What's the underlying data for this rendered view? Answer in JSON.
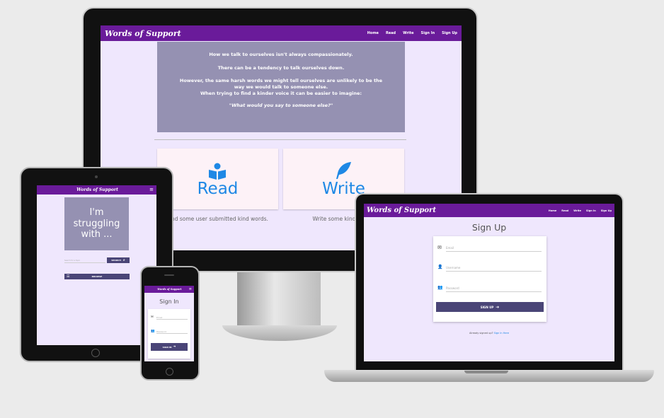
{
  "brand": "Words of Support",
  "nav": {
    "home": "Home",
    "read": "Read",
    "write": "Write",
    "signin": "Sign In",
    "signup": "Sign Up"
  },
  "hero": {
    "line1": "How we talk to ourselves isn't always compassionately.",
    "line2": "There can be a tendency to talk ourselves down.",
    "line3a": "However, the same harsh words we might tell ourselves are unlikely to be the",
    "line3b": "way we would talk to someone else.",
    "line4": "When trying to find a kinder voice it can be easier to imagine:",
    "quote": "\"What would you say to someone else?\""
  },
  "cards": {
    "read": {
      "title": "Read",
      "caption": "Find some user submitted kind words."
    },
    "write": {
      "title": "Write",
      "caption": "Write some kind words."
    }
  },
  "tablet": {
    "struggle_line1": "I'm",
    "struggle_line2": "struggling",
    "struggle_line3": "with ...",
    "search_placeholder": "Search for a topic",
    "search_button": "SEARCH",
    "browse_button": "BROWSE"
  },
  "phone": {
    "title": "Sign In",
    "email": "Email",
    "password": "Password",
    "button": "SIGN IN"
  },
  "laptop": {
    "title": "Sign Up",
    "email": "Email",
    "username": "Username",
    "password": "Password",
    "button": "SIGN UP",
    "footer_text": "Already signed up?",
    "footer_link": "Sign In Here"
  },
  "colors": {
    "navbar": "#6a1b9a",
    "background": "#efe7fd",
    "hero": "#9591b2",
    "button": "#4a4577",
    "accent": "#1e88e5"
  }
}
